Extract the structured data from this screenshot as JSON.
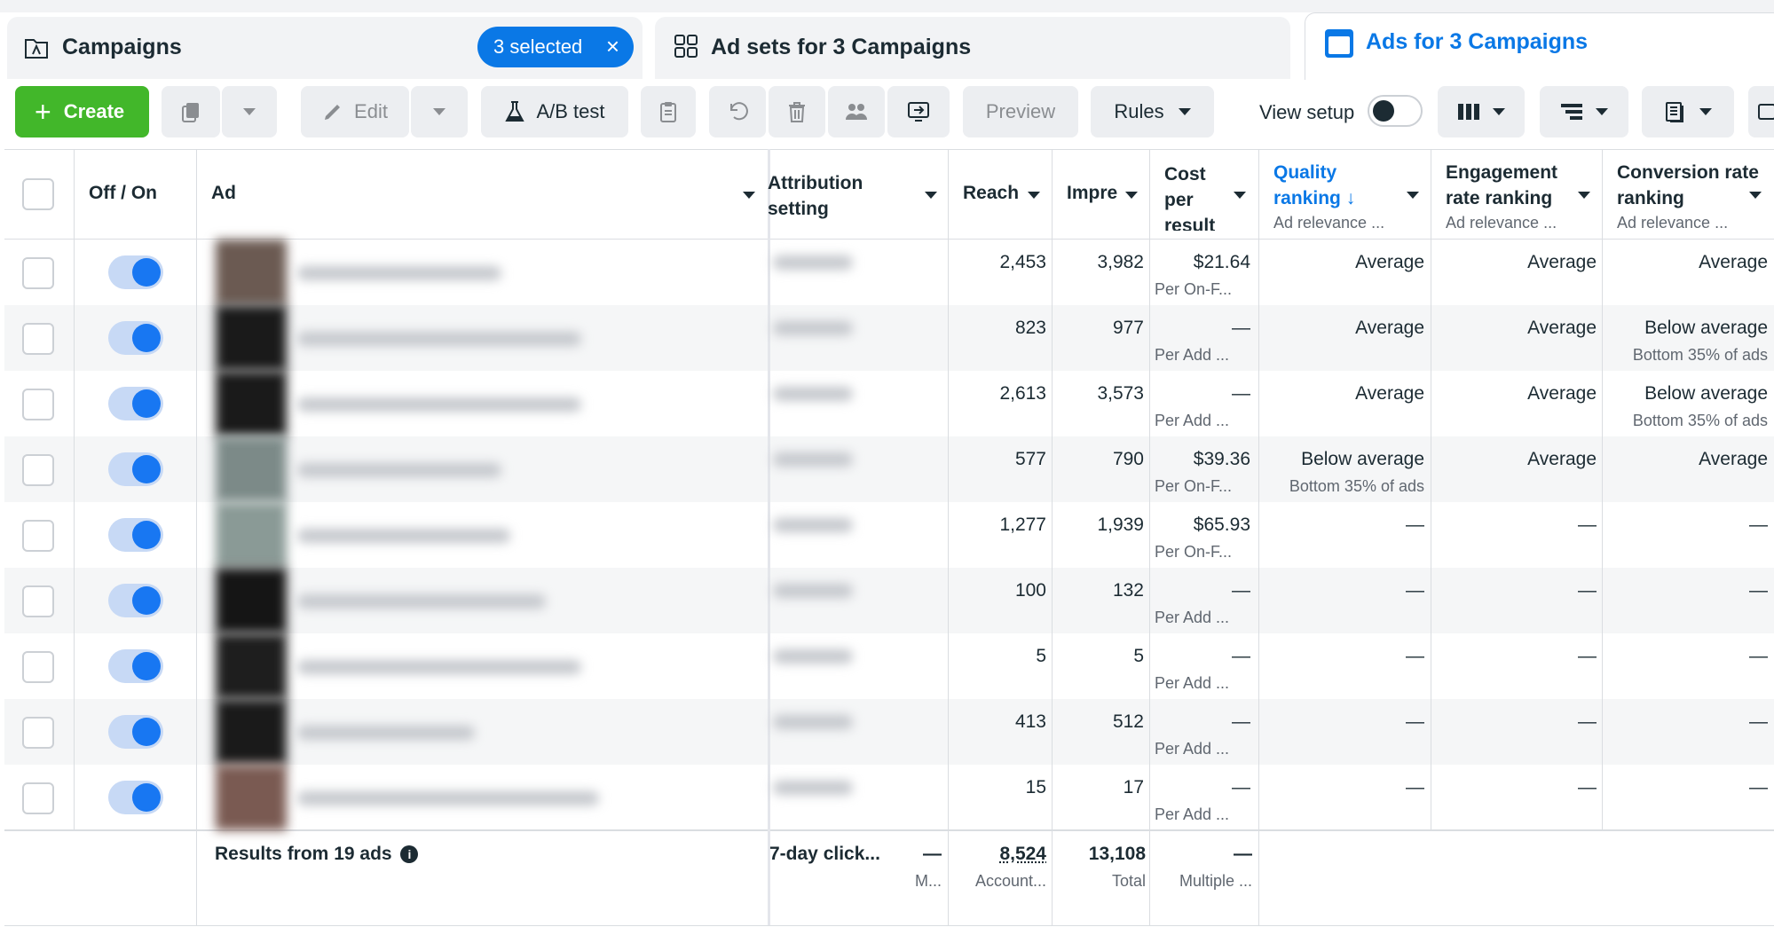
{
  "tabs": {
    "campaigns_label": "Campaigns",
    "selected_label": "3 selected",
    "adsets_label": "Ad sets for 3 Campaigns",
    "ads_label": "Ads for 3 Campaigns"
  },
  "toolbar": {
    "create_label": "Create",
    "edit_label": "Edit",
    "ab_test_label": "A/B test",
    "preview_label": "Preview",
    "rules_label": "Rules",
    "view_setup_label": "View setup"
  },
  "table": {
    "headers": {
      "off_on": "Off / On",
      "ad": "Ad",
      "attribution": "Attribution setting",
      "reach": "Reach",
      "impressions": "Impre",
      "cost": "Cost per result",
      "quality": "Quality ranking",
      "quality_sub": "Ad relevance ...",
      "engagement": "Engagement rate ranking",
      "engagement_sub": "Ad relevance ...",
      "conversion": "Conversion rate ranking",
      "conversion_sub": "Ad relevance ..."
    },
    "rows": [
      {
        "reach": "2,453",
        "impr": "3,982",
        "cost": "$21.64",
        "cost_sub": "Per On-F...",
        "quality": "Average",
        "quality_sub": "",
        "engagement": "Average",
        "conversion": "Average",
        "conversion_sub": ""
      },
      {
        "reach": "823",
        "impr": "977",
        "cost": "—",
        "cost_sub": "Per Add ...",
        "quality": "Average",
        "quality_sub": "",
        "engagement": "Average",
        "conversion": "Below average",
        "conversion_sub": "Bottom 35% of ads"
      },
      {
        "reach": "2,613",
        "impr": "3,573",
        "cost": "—",
        "cost_sub": "Per Add ...",
        "quality": "Average",
        "quality_sub": "",
        "engagement": "Average",
        "conversion": "Below average",
        "conversion_sub": "Bottom 35% of ads"
      },
      {
        "reach": "577",
        "impr": "790",
        "cost": "$39.36",
        "cost_sub": "Per On-F...",
        "quality": "Below average",
        "quality_sub": "Bottom 35% of ads",
        "engagement": "Average",
        "conversion": "Average",
        "conversion_sub": ""
      },
      {
        "reach": "1,277",
        "impr": "1,939",
        "cost": "$65.93",
        "cost_sub": "Per On-F...",
        "quality": "—",
        "quality_sub": "",
        "engagement": "—",
        "conversion": "—",
        "conversion_sub": ""
      },
      {
        "reach": "100",
        "impr": "132",
        "cost": "—",
        "cost_sub": "Per Add ...",
        "quality": "—",
        "quality_sub": "",
        "engagement": "—",
        "conversion": "—",
        "conversion_sub": ""
      },
      {
        "reach": "5",
        "impr": "5",
        "cost": "—",
        "cost_sub": "Per Add ...",
        "quality": "—",
        "quality_sub": "",
        "engagement": "—",
        "conversion": "—",
        "conversion_sub": ""
      },
      {
        "reach": "413",
        "impr": "512",
        "cost": "—",
        "cost_sub": "Per Add ...",
        "quality": "—",
        "quality_sub": "",
        "engagement": "—",
        "conversion": "—",
        "conversion_sub": ""
      },
      {
        "reach": "15",
        "impr": "17",
        "cost": "—",
        "cost_sub": "Per Add ...",
        "quality": "—",
        "quality_sub": "",
        "engagement": "—",
        "conversion": "—",
        "conversion_sub": ""
      }
    ],
    "footer": {
      "results_label": "Results from 19 ads",
      "attribution": "7-day click...",
      "col_dash": "—",
      "col_dash_sub": "M...",
      "reach": "8,524",
      "reach_sub": "Account...",
      "impr": "13,108",
      "impr_sub": "Total",
      "cost": "—",
      "cost_sub": "Multiple ..."
    }
  },
  "colors": {
    "accent": "#0a78e6",
    "create_green": "#42b72a",
    "toggle_blue": "#1877f2"
  }
}
